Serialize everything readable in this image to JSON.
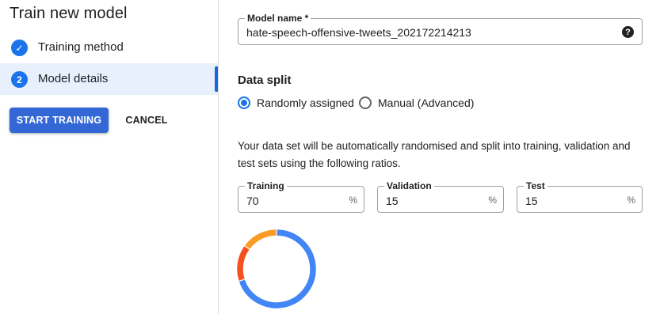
{
  "sidebar": {
    "title": "Train new model",
    "steps": [
      {
        "badge": "✓",
        "label": "Training method",
        "state": "done"
      },
      {
        "badge": "2",
        "label": "Model details",
        "state": "active"
      }
    ],
    "start_button": "START TRAINING",
    "cancel_button": "CANCEL"
  },
  "form": {
    "model_name": {
      "label": "Model name *",
      "value": "hate-speech-offensive-tweets_202172214213",
      "help_icon": "?"
    },
    "data_split": {
      "title": "Data split",
      "options": [
        {
          "label": "Randomly assigned",
          "selected": true
        },
        {
          "label": "Manual (Advanced)",
          "selected": false
        }
      ],
      "description": "Your data set will be automatically randomised and split into training, validation and test sets using the following ratios.",
      "fields": [
        {
          "label": "Training",
          "value": "70",
          "unit": "%"
        },
        {
          "label": "Validation",
          "value": "15",
          "unit": "%"
        },
        {
          "label": "Test",
          "value": "15",
          "unit": "%"
        }
      ]
    },
    "split_ring": {
      "segments": [
        {
          "name": "Training",
          "percent": 70,
          "color": "#4285f4"
        },
        {
          "name": "Validation",
          "percent": 15,
          "color": "#f4511e"
        },
        {
          "name": "Test",
          "percent": 15,
          "color": "#fa9b26"
        }
      ]
    }
  },
  "colors": {
    "accent": "#1a73e8",
    "primary_button": "#3367d6",
    "active_step_bg": "#e8f0fe"
  }
}
